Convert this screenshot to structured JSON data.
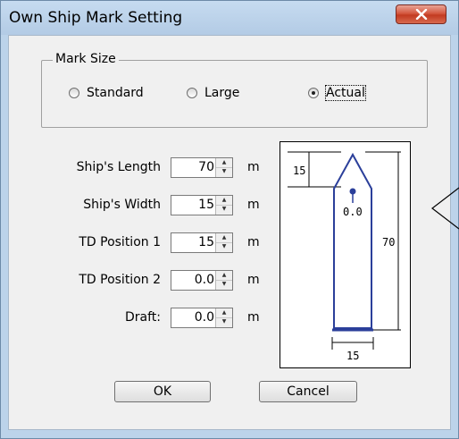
{
  "window": {
    "title": "Own Ship Mark Setting"
  },
  "mark_size": {
    "legend": "Mark Size",
    "options": [
      {
        "label": "Standard",
        "selected": false
      },
      {
        "label": "Large",
        "selected": false
      },
      {
        "label": "Actual",
        "selected": true
      }
    ]
  },
  "fields": [
    {
      "label": "Ship's Length",
      "value": "70",
      "unit": "m"
    },
    {
      "label": "Ship's Width",
      "value": "15",
      "unit": "m"
    },
    {
      "label": "TD Position 1",
      "value": "15",
      "unit": "m"
    },
    {
      "label": "TD Position 2",
      "value": "0.0",
      "unit": "m"
    },
    {
      "label": "Draft:",
      "value": "0.0",
      "unit": "m"
    }
  ],
  "diagram": {
    "bow_length": "15",
    "td_position": "0.0",
    "length": "70",
    "width": "15"
  },
  "buttons": {
    "ok": "OK",
    "cancel": "Cancel"
  },
  "colors": {
    "ship_outline": "#2b3f9a",
    "close_button": "#c84a32"
  }
}
